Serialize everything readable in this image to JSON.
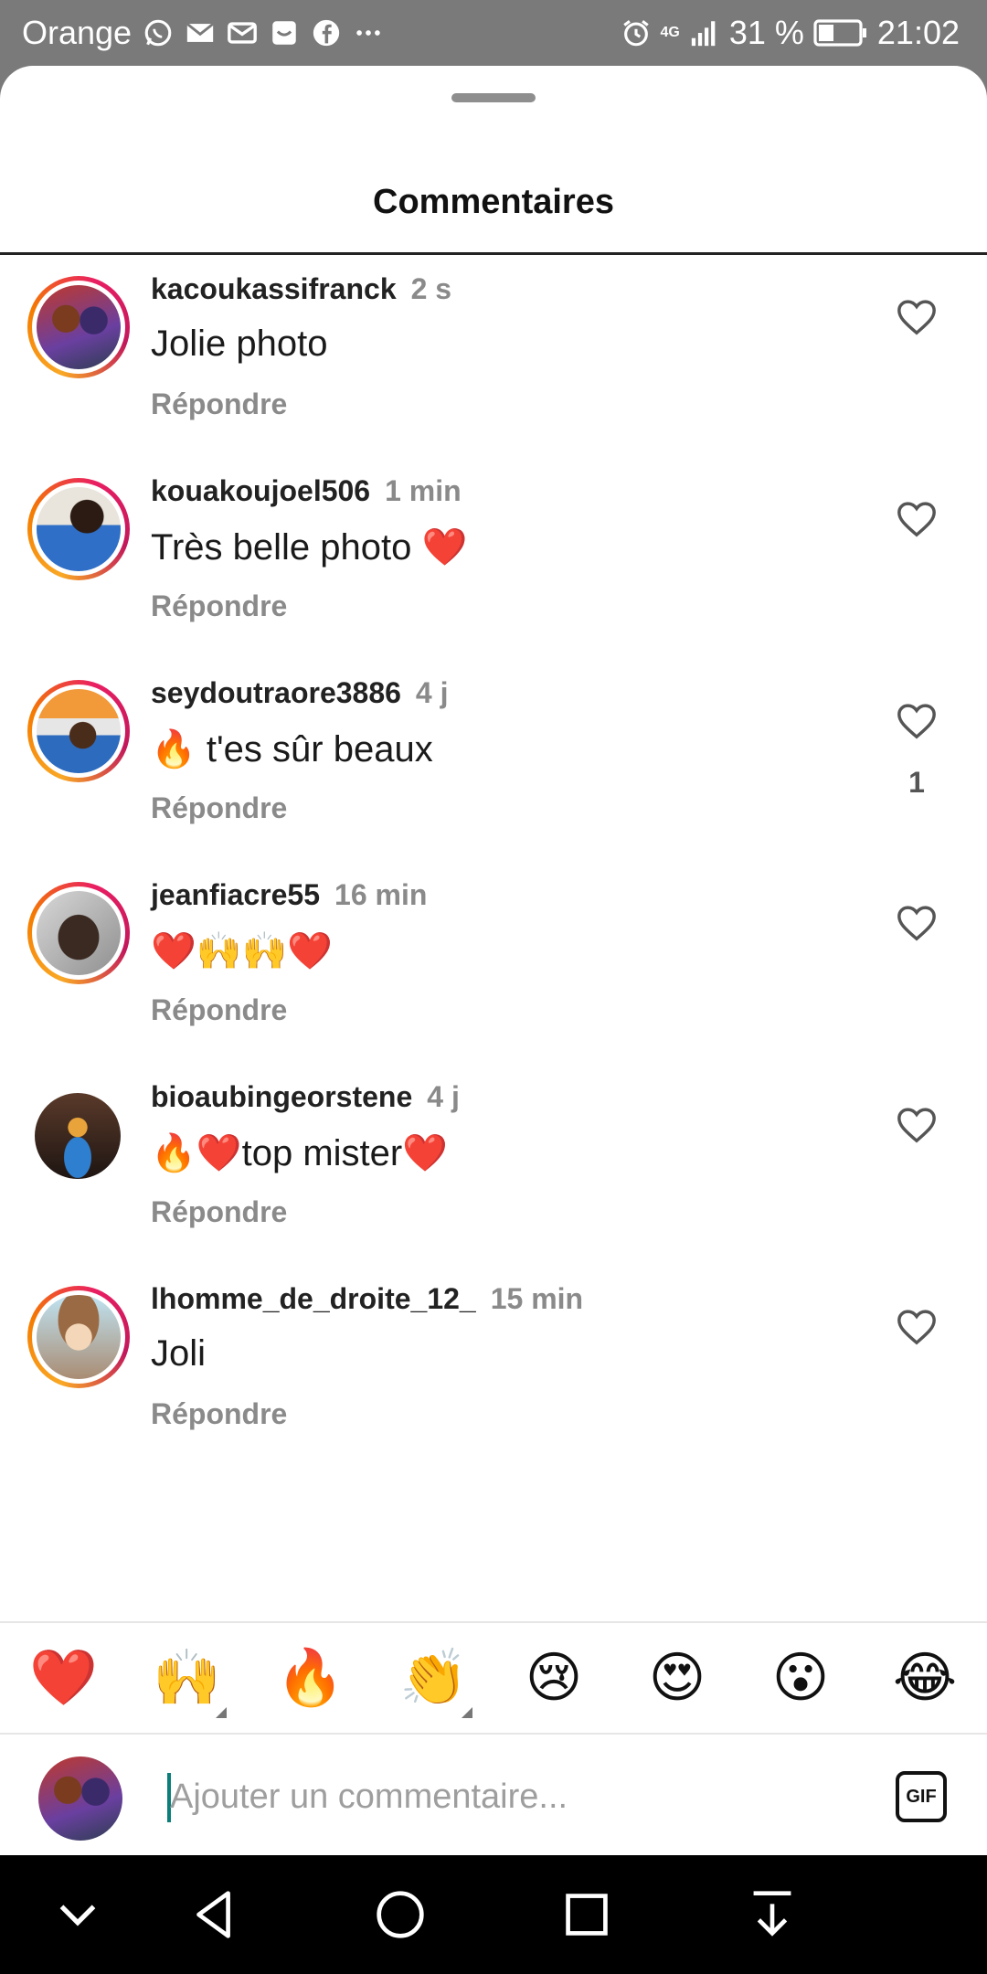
{
  "status_bar": {
    "carrier": "Orange",
    "battery": "31 %",
    "time": "21:02",
    "network": "4G",
    "icons": [
      "whatsapp-icon",
      "mail-icon",
      "gmail-icon",
      "inbox-icon",
      "facebook-icon",
      "more-icon",
      "alarm-icon",
      "signal-icon",
      "battery-icon"
    ]
  },
  "sheet": {
    "title": "Commentaires"
  },
  "comments": [
    {
      "username": "kacoukassifranck",
      "time": "2 s",
      "text": "Jolie photo",
      "reply_label": "Répondre",
      "likes": "",
      "ring": true,
      "avatar_color": "#a0522d"
    },
    {
      "username": "kouakoujoel506",
      "time": "1 min",
      "text": "Très belle photo ❤️",
      "reply_label": "Répondre",
      "likes": "",
      "ring": true,
      "avatar_color": "#3b6fb6"
    },
    {
      "username": "seydoutraore3886",
      "time": "4 j",
      "text": "🔥 t'es sûr beaux",
      "reply_label": "Répondre",
      "likes": "1",
      "ring": true,
      "avatar_color": "#e07b2a"
    },
    {
      "username": "jeanfiacre55",
      "time": "16 min",
      "text": "❤️🙌🙌❤️",
      "reply_label": "Répondre",
      "likes": "",
      "ring": true,
      "avatar_color": "#6d6d6d"
    },
    {
      "username": "bioaubingeorstene",
      "time": "4 j",
      "text": "🔥❤️top mister❤️",
      "reply_label": "Répondre",
      "likes": "",
      "ring": false,
      "avatar_color": "#3a2a22"
    },
    {
      "username": "lhomme_de_droite_12_",
      "time": "15 min",
      "text": "Joli",
      "reply_label": "Répondre",
      "likes": "",
      "ring": true,
      "avatar_color": "#c8a27a"
    }
  ],
  "emoji_bar": [
    "❤️",
    "🙌",
    "🔥",
    "👏",
    "😢",
    "😍",
    "😮",
    "😂"
  ],
  "composer": {
    "placeholder": "Ajouter un commentaire...",
    "gif_label": "GIF"
  },
  "nav_bar": [
    "chevron-down-icon",
    "back-icon",
    "home-icon",
    "recents-icon",
    "pull-down-icon"
  ],
  "colors": {
    "accent_ring_start": "#f9a825",
    "accent_ring_end": "#c2185b",
    "caret": "#0a7e78"
  }
}
